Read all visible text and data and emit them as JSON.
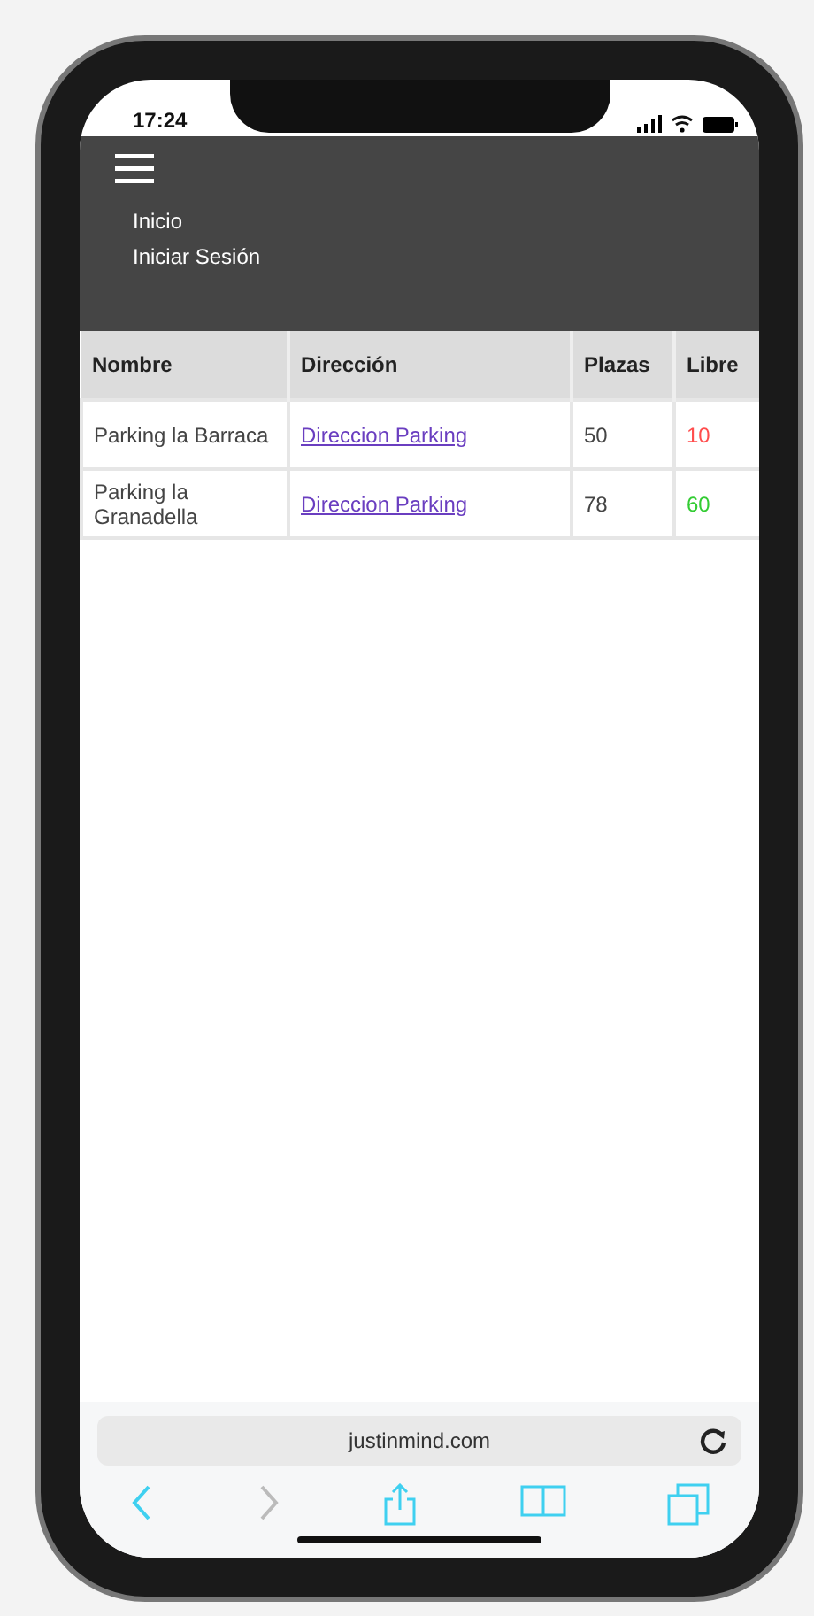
{
  "status_bar": {
    "time": "17:24"
  },
  "nav": {
    "items": [
      {
        "label": "Inicio"
      },
      {
        "label": "Iniciar Sesión"
      }
    ]
  },
  "table": {
    "columns": [
      "Nombre",
      "Dirección",
      "Plazas",
      "Libre"
    ],
    "rows": [
      {
        "name": "Parking la Barraca",
        "address": "Direccion Parking",
        "spaces": "50",
        "free": "10",
        "color": "#ff4d4d"
      },
      {
        "name": "Parking la Granadella",
        "address": "Direccion Parking",
        "spaces": "78",
        "free": "60",
        "color": "#33cc33"
      }
    ]
  },
  "browser": {
    "url": "justinmind.com",
    "toolbar": [
      {
        "kind": "back",
        "disabled": false
      },
      {
        "kind": "forward",
        "disabled": true
      },
      {
        "kind": "share",
        "disabled": false
      },
      {
        "kind": "bookmarks",
        "disabled": false
      },
      {
        "kind": "tabs",
        "disabled": false
      }
    ]
  }
}
